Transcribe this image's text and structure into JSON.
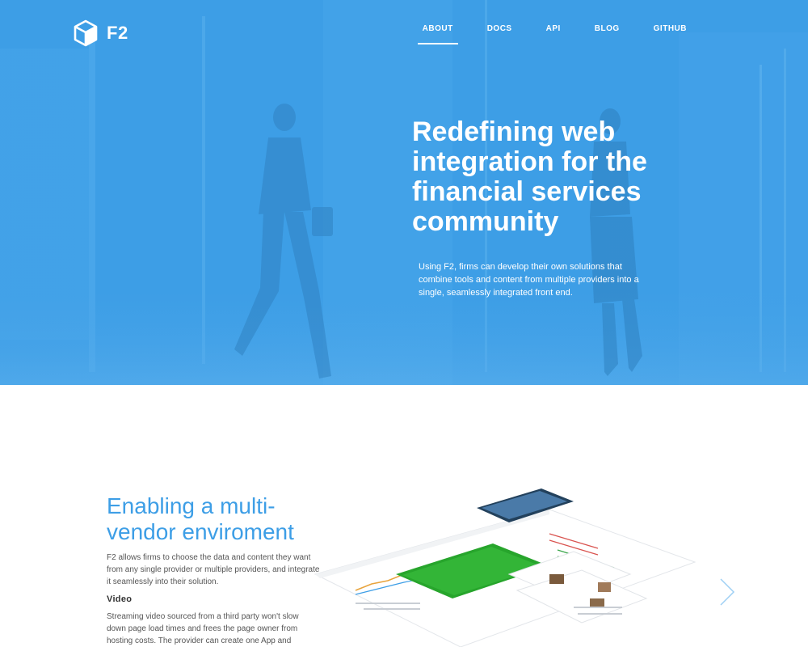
{
  "brand": {
    "name": "F2",
    "icon": "cube-logo-icon"
  },
  "nav": {
    "items": [
      {
        "label": "ABOUT",
        "active": true
      },
      {
        "label": "DOCS",
        "active": false
      },
      {
        "label": "API",
        "active": false
      },
      {
        "label": "BLOG",
        "active": false
      },
      {
        "label": "GITHUB",
        "active": false
      }
    ]
  },
  "hero": {
    "title": "Redefining web integration for the financial services community",
    "text": "Using F2, firms can develop their own solutions that combine tools and content from multiple providers into a single, seamlessly integrated front end."
  },
  "section": {
    "title": "Enabling a multi-vendor enviroment",
    "description": "F2 allows firms to choose the data and content they want from any single provider or multiple providers, and integrate it seamlessly into their solution.",
    "subheading": "Video",
    "subtext": "Streaming video sourced from a third party won't slow down page load times and frees the page owner from hosting costs. The provider can create one App and deploy it many times,"
  },
  "colors": {
    "primary": "#3d9ee6",
    "white": "#ffffff"
  },
  "icons": {
    "next": "chevron-right-icon"
  }
}
